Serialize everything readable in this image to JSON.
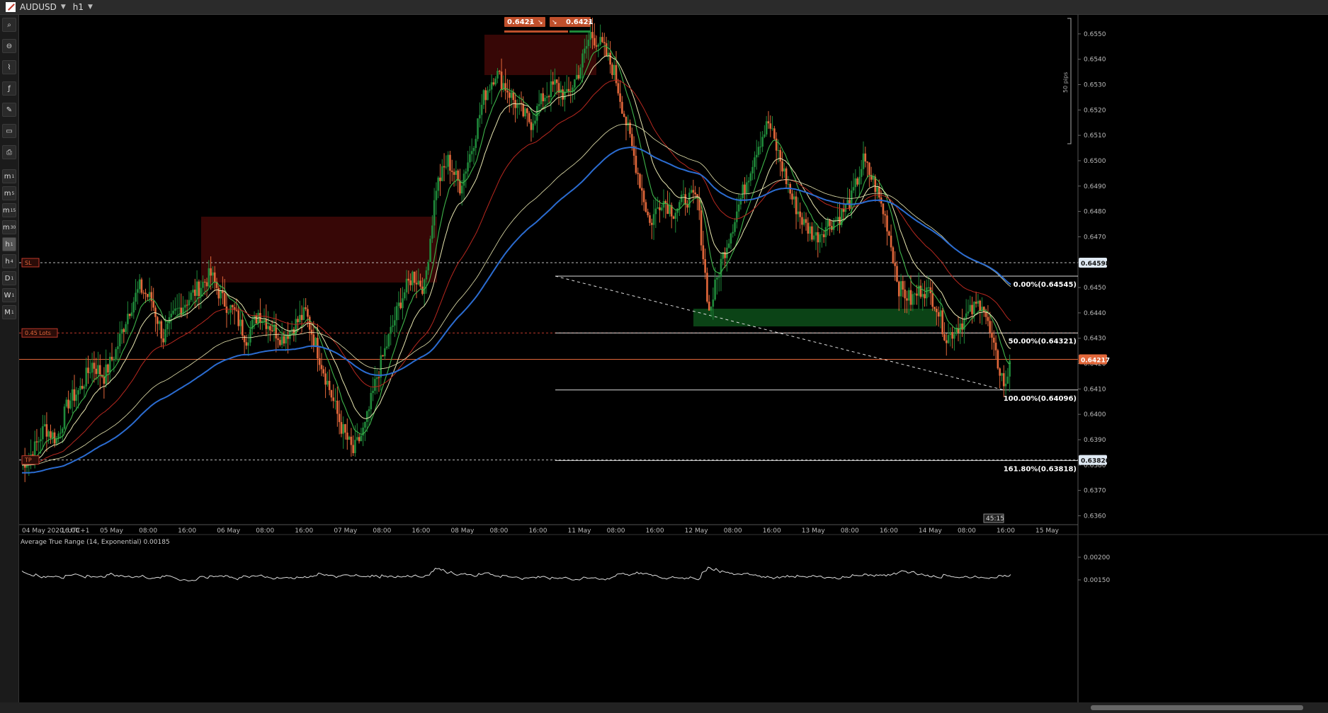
{
  "window": {
    "symbol": "AUDUSD",
    "timeframe": "h1"
  },
  "toolbar": {
    "tools": [
      "zoom-in-icon",
      "zoom-out-icon",
      "chart-type-icon",
      "indicators-icon",
      "drawing-tools-icon",
      "objects-icon",
      "screenshot-icon"
    ],
    "timeframes": [
      {
        "main": "m",
        "sub": "1"
      },
      {
        "main": "m",
        "sub": "5"
      },
      {
        "main": "m",
        "sub": "15"
      },
      {
        "main": "m",
        "sub": "30"
      },
      {
        "main": "h",
        "sub": "1",
        "active": true
      },
      {
        "main": "h",
        "sub": "4"
      },
      {
        "main": "D",
        "sub": "1"
      },
      {
        "main": "W",
        "sub": "1"
      },
      {
        "main": "M",
        "sub": "1"
      }
    ]
  },
  "colors": {
    "bull": "#1f8a3a",
    "bear": "#e2673a",
    "ema_blue": "#2b6cd1",
    "ema_red": "#b8281f",
    "line_green": "#3eb44a",
    "line_yellow": "#e8e6b0",
    "price_line": "#e2673a",
    "zone_red": "#4a0a08",
    "zone_green": "#0c4a18",
    "bg": "#000000"
  },
  "trade_panel": {
    "sell_price": "0.6421",
    "sell_pip": "7",
    "buy_price": "0.6421",
    "buy_pip": "7"
  },
  "labels": {
    "sl": "SL",
    "lots": "0.45 Lots",
    "tp": "TP",
    "range_label": "50 pips",
    "countdown": "45:15",
    "indicator_title": "Average True Range (14, Exponential) 0.00185"
  },
  "price_tags": {
    "sl": "0.64598",
    "current": "0.64217",
    "tp": "0.63820"
  },
  "fibonacci": [
    {
      "label": "0.00%(0.64545)",
      "price": 0.64545
    },
    {
      "label": "50.00%(0.64321)",
      "price": 0.64321
    },
    {
      "label": "100.00%(0.64096)",
      "price": 0.64096
    },
    {
      "label": "161.80%(0.63818)",
      "price": 0.63818
    }
  ],
  "chart_data": {
    "type": "candlestick",
    "symbol": "AUDUSD",
    "timeframe": "h1",
    "y_ticks": [
      "0.6550",
      "0.6540",
      "0.6530",
      "0.6520",
      "0.6510",
      "0.6500",
      "0.6490",
      "0.6480",
      "0.6470",
      "0.6460",
      "0.6450",
      "0.6440",
      "0.6430",
      "0.6420",
      "0.6410",
      "0.6400",
      "0.6390",
      "0.6380",
      "0.6370",
      "0.6360"
    ],
    "ylim": [
      0.63565,
      0.65575
    ],
    "x_ticks": [
      "04 May 2020, UTC+1",
      "16:00",
      "05 May",
      "08:00",
      "16:00",
      "06 May",
      "08:00",
      "16:00",
      "07 May",
      "08:00",
      "16:00",
      "08 May",
      "08:00",
      "16:00",
      "11 May",
      "08:00",
      "16:00",
      "12 May",
      "08:00",
      "16:00",
      "13 May",
      "08:00",
      "16:00",
      "14 May",
      "08:00",
      "16:00",
      "15 May"
    ],
    "levels": {
      "stop_loss": 0.64598,
      "entry": 0.64321,
      "current": 0.64217,
      "take_profit": 0.6382
    },
    "atr": {
      "period": 14,
      "mode": "Exponential",
      "value": 0.00185,
      "y_ticks": [
        "0.00200",
        "0.00150"
      ]
    },
    "close_path": [
      [
        0,
        0.638
      ],
      [
        6,
        0.6385
      ],
      [
        12,
        0.6395
      ],
      [
        18,
        0.639
      ],
      [
        24,
        0.6405
      ],
      [
        30,
        0.641
      ],
      [
        36,
        0.642
      ],
      [
        42,
        0.6415
      ],
      [
        48,
        0.6425
      ],
      [
        54,
        0.644
      ],
      [
        60,
        0.645
      ],
      [
        66,
        0.6445
      ],
      [
        72,
        0.643
      ],
      [
        78,
        0.644
      ],
      [
        84,
        0.6445
      ],
      [
        90,
        0.645
      ],
      [
        96,
        0.6455
      ],
      [
        102,
        0.6445
      ],
      [
        108,
        0.644
      ],
      [
        114,
        0.643
      ],
      [
        120,
        0.644
      ],
      [
        126,
        0.6435
      ],
      [
        132,
        0.643
      ],
      [
        138,
        0.6435
      ],
      [
        144,
        0.644
      ],
      [
        150,
        0.6425
      ],
      [
        156,
        0.641
      ],
      [
        162,
        0.6395
      ],
      [
        168,
        0.6385
      ],
      [
        174,
        0.6395
      ],
      [
        180,
        0.6415
      ],
      [
        186,
        0.643
      ],
      [
        192,
        0.6445
      ],
      [
        198,
        0.6455
      ],
      [
        204,
        0.645
      ],
      [
        210,
        0.649
      ],
      [
        216,
        0.65
      ],
      [
        222,
        0.649
      ],
      [
        228,
        0.6505
      ],
      [
        234,
        0.6525
      ],
      [
        240,
        0.6535
      ],
      [
        246,
        0.6528
      ],
      [
        252,
        0.652
      ],
      [
        258,
        0.6515
      ],
      [
        264,
        0.6525
      ],
      [
        270,
        0.653
      ],
      [
        276,
        0.6525
      ],
      [
        282,
        0.6535
      ],
      [
        288,
        0.655
      ],
      [
        294,
        0.6545
      ],
      [
        300,
        0.6535
      ],
      [
        306,
        0.6515
      ],
      [
        312,
        0.6495
      ],
      [
        318,
        0.6475
      ],
      [
        324,
        0.6485
      ],
      [
        330,
        0.648
      ],
      [
        336,
        0.6485
      ],
      [
        342,
        0.6485
      ],
      [
        348,
        0.644
      ],
      [
        354,
        0.646
      ],
      [
        360,
        0.6475
      ],
      [
        366,
        0.649
      ],
      [
        372,
        0.6505
      ],
      [
        378,
        0.6515
      ],
      [
        384,
        0.65
      ],
      [
        390,
        0.6485
      ],
      [
        396,
        0.6475
      ],
      [
        402,
        0.647
      ],
      [
        408,
        0.6475
      ],
      [
        414,
        0.6478
      ],
      [
        420,
        0.6485
      ],
      [
        426,
        0.65
      ],
      [
        432,
        0.649
      ],
      [
        438,
        0.6475
      ],
      [
        444,
        0.645
      ],
      [
        450,
        0.6445
      ],
      [
        456,
        0.645
      ],
      [
        462,
        0.6445
      ],
      [
        468,
        0.643
      ],
      [
        474,
        0.6435
      ],
      [
        480,
        0.644
      ],
      [
        486,
        0.6445
      ],
      [
        492,
        0.6425
      ],
      [
        498,
        0.641
      ],
      [
        500,
        0.6422
      ]
    ]
  }
}
